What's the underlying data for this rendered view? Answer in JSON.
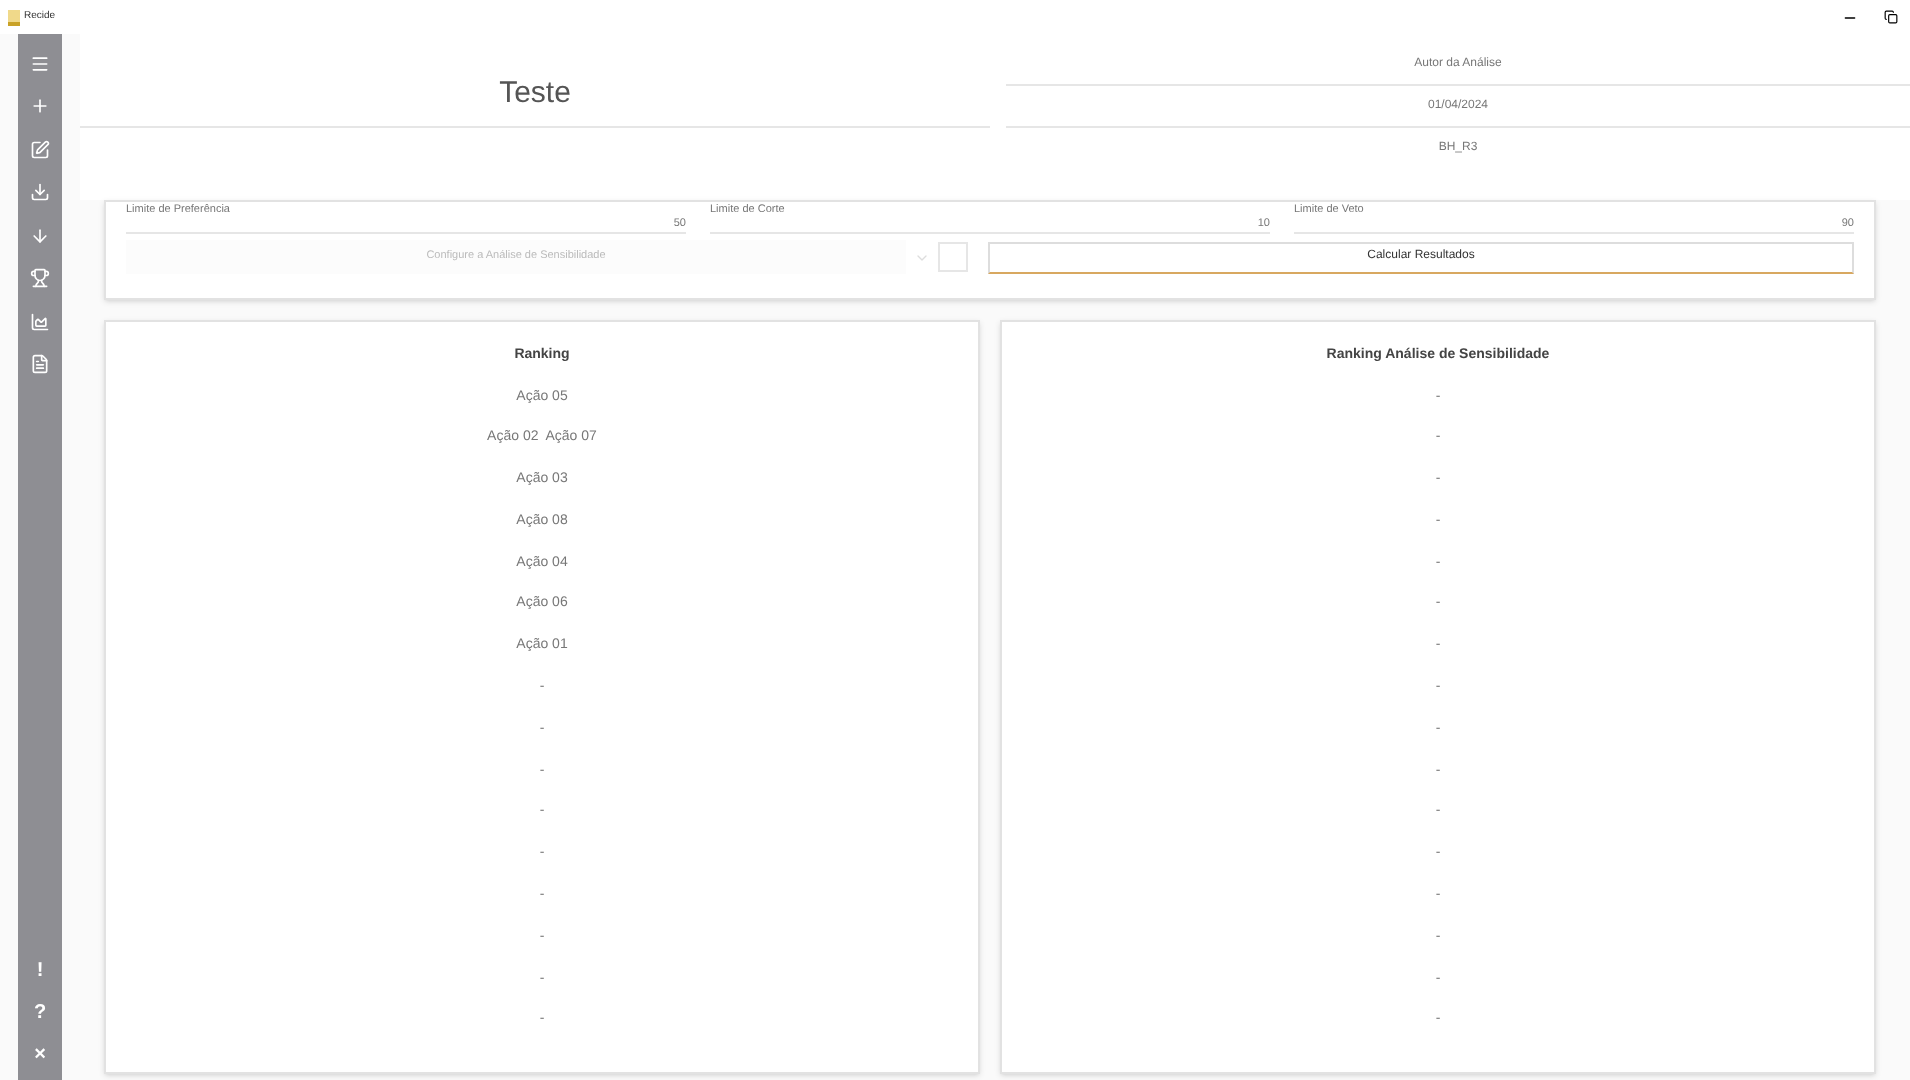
{
  "window": {
    "title": "Recide"
  },
  "sidebar": {
    "items": [
      {
        "kind": "menu"
      },
      {
        "kind": "plus"
      },
      {
        "kind": "edit"
      },
      {
        "kind": "download"
      },
      {
        "kind": "arrow"
      },
      {
        "kind": "trophy"
      },
      {
        "kind": "chart"
      },
      {
        "kind": "report"
      }
    ],
    "bottom": [
      "!",
      "?",
      "×"
    ]
  },
  "header": {
    "title": "Teste",
    "author": "Autor da Análise",
    "date": "01/04/2024",
    "code": "BH_R3"
  },
  "limits": [
    {
      "label": "Limite de Preferência",
      "value": "50"
    },
    {
      "label": "Limite de Corte",
      "value": "10"
    },
    {
      "label": "Limite de Veto",
      "value": "90"
    }
  ],
  "sensitivity": {
    "placeholder": "Configure a Análise de Sensibilidade",
    "checked": false
  },
  "calculate_button": "Calcular Resultados",
  "ranking": {
    "title": "Ranking",
    "rows": [
      "Ação 05",
      "Ação 02  Ação 07",
      "Ação 03",
      "Ação 08",
      "Ação 04",
      "Ação 06",
      "Ação 01",
      "-",
      "-",
      "-",
      "-",
      "-",
      "-",
      "-",
      "-",
      "-"
    ]
  },
  "sensitivity_ranking": {
    "title": "Ranking Análise de Sensibilidade",
    "rows": [
      "-",
      "-",
      "-",
      "-",
      "-",
      "-",
      "-",
      "-",
      "-",
      "-",
      "-",
      "-",
      "-",
      "-",
      "-",
      "-"
    ]
  }
}
